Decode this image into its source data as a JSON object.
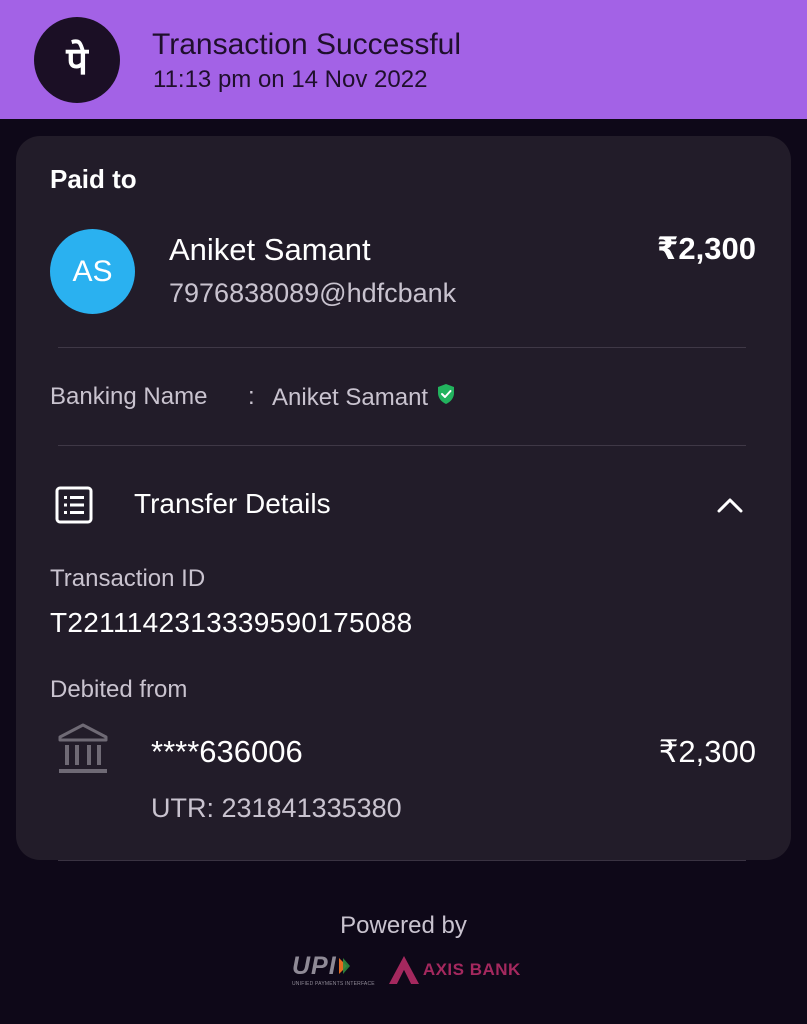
{
  "header": {
    "title": "Transaction Successful",
    "subtitle": "11:13 pm on 14 Nov 2022",
    "logo_icon": "phonepe-logo-icon",
    "logo_glyph": "पे",
    "background": "#a362e6"
  },
  "paid_to": {
    "label": "Paid to",
    "avatar_initials": "AS",
    "avatar_color": "#2ab1f0",
    "name": "Aniket Samant",
    "vpa": "7976838089@hdfcbank",
    "amount": "₹2,300"
  },
  "banking_name": {
    "label": "Banking Name",
    "separator": ":",
    "value": "Aniket Samant",
    "verified_icon": "verified-shield-icon",
    "verified_color": "#22b35e"
  },
  "transfer_details": {
    "label": "Transfer Details",
    "icon": "receipt-list-icon",
    "toggle_icon": "chevron-up-icon",
    "transaction_id_label": "Transaction ID",
    "transaction_id": "T2211142313339590175088",
    "debited_from_label": "Debited from",
    "bank_icon": "bank-icon",
    "account": "****636006",
    "amount": "₹2,300",
    "utr": "UTR: 231841335380"
  },
  "footer": {
    "powered_by": "Powered by",
    "upi_logo_text": "UPI",
    "upi_tagline": "UNIFIED PAYMENTS INTERFACE",
    "bank_name": "AXIS BANK",
    "bank_color": "#a4285e"
  }
}
